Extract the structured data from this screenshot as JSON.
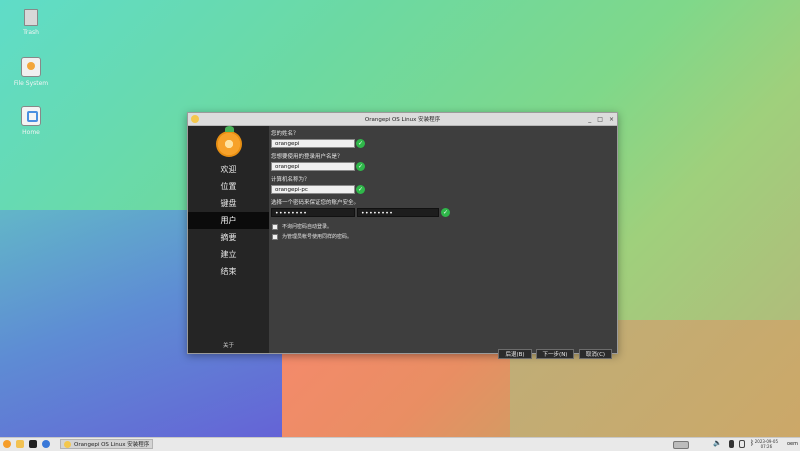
{
  "desktop": {
    "icons": [
      {
        "name": "trash",
        "label": "Trash"
      },
      {
        "name": "file-system",
        "label": "File System"
      },
      {
        "name": "home",
        "label": "Home"
      }
    ]
  },
  "window": {
    "title": "Orangepi OS Linux 安装程序",
    "controls": [
      "_",
      "□",
      "×"
    ]
  },
  "sidebar": {
    "steps": [
      {
        "label": "欢迎",
        "active": false
      },
      {
        "label": "位置",
        "active": false
      },
      {
        "label": "键盘",
        "active": false
      },
      {
        "label": "用户",
        "active": true
      },
      {
        "label": "摘要",
        "active": false
      },
      {
        "label": "建立",
        "active": false
      },
      {
        "label": "结束",
        "active": false
      }
    ],
    "about": "关于"
  },
  "form": {
    "name_q": "您的姓名？",
    "name_value": "orangepi",
    "login_q": "您想要使用的登录用户名是？",
    "login_value": "orangepi",
    "host_q": "计算机名称为？",
    "host_value": "orangepi-pc",
    "password_q": "选择一个密码来保证您的账户安全。",
    "password_value": "••••••••",
    "password_confirm_value": "••••••••",
    "autologin_label": "不询问密码自动登录。",
    "admin_same_label": "为管理员帐号使用同样的密码。"
  },
  "buttons": {
    "back": "后退(B)",
    "next": "下一步(N)",
    "cancel": "取消(C)"
  },
  "taskbar": {
    "task_label": "Orangepi OS Linux 安装程序",
    "clock_date": "2023-09-05",
    "clock_time": "07:26",
    "user": "oem"
  },
  "colors": {
    "check_green": "#2fb84a",
    "window_bg": "#3e3e3e",
    "sidebar_bg": "#252525"
  }
}
